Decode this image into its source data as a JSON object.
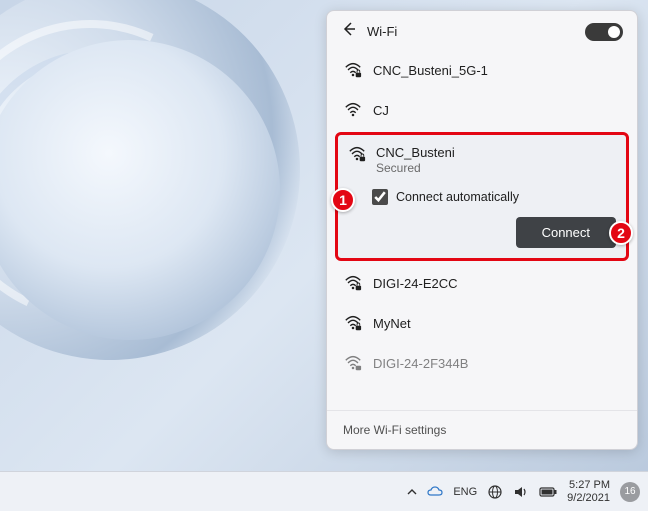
{
  "panel": {
    "title": "Wi-Fi",
    "toggle_on": true,
    "more_settings": "More Wi-Fi settings"
  },
  "networks": [
    {
      "name": "CNC_Busteni_5G-1",
      "secured": true
    },
    {
      "name": "CJ",
      "secured": false
    },
    {
      "name": "DIGI-24-E2CC",
      "secured": true
    },
    {
      "name": "MyNet",
      "secured": true
    },
    {
      "name": "DIGI-24-2F344B",
      "secured": true
    }
  ],
  "selected": {
    "name": "CNC_Busteni",
    "status": "Secured",
    "auto_label": "Connect automatically",
    "auto_checked": true,
    "connect_label": "Connect"
  },
  "annotations": {
    "bubble1": "1",
    "bubble2": "2"
  },
  "taskbar": {
    "lang": "ENG",
    "time": "5:27 PM",
    "date": "9/2/2021",
    "notif_count": "16"
  }
}
